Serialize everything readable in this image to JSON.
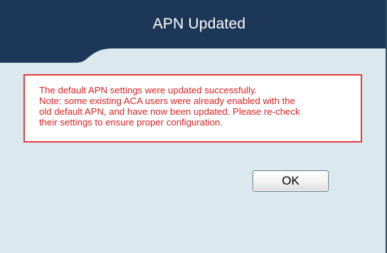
{
  "dialog": {
    "title": "APN Updated",
    "message_lines": [
      "The default APN settings were updated successfully.",
      "Note: some existing ACA users were already enabled with the",
      "old default APN, and have now been updated. Please re-check",
      "their settings to ensure proper configuration."
    ],
    "ok_label": "OK"
  },
  "colors": {
    "header": "#1c3757",
    "body_background": "#dbe8ee",
    "message_border": "#e63b3b",
    "message_text": "#e31f1f"
  }
}
